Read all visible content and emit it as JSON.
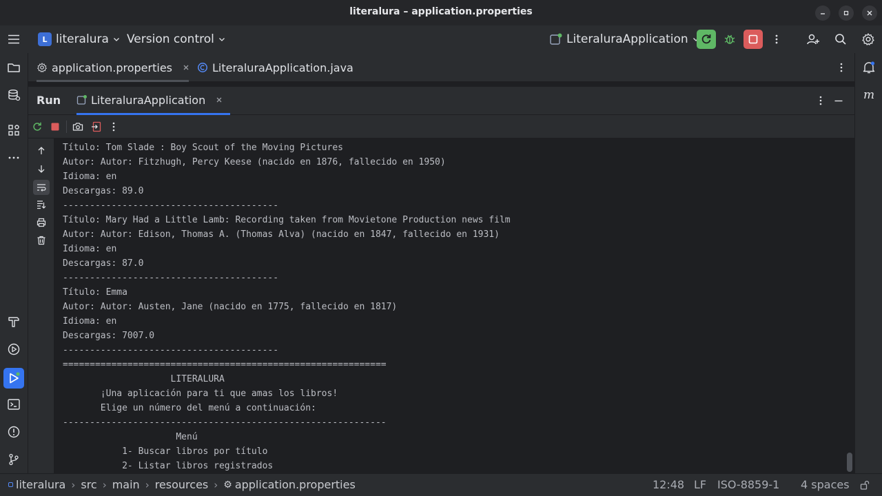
{
  "window": {
    "title": "literalura – application.properties"
  },
  "toolbar": {
    "project_badge": "L",
    "project_name": "literalura",
    "version_control": "Version control",
    "run_config": "LiteraluraApplication"
  },
  "editor_tabs": [
    {
      "label": "application.properties",
      "active": true
    },
    {
      "label": "LiteraluraApplication.java",
      "active": false
    }
  ],
  "run_window": {
    "title": "Run",
    "tab_label": "LiteraluraApplication"
  },
  "console": {
    "lines": [
      "Título: Tom Slade : Boy Scout of the Moving Pictures",
      "Autor: Autor: Fitzhugh, Percy Keese (nacido en 1876, fallecido en 1950)",
      "Idioma: en",
      "Descargas: 89.0",
      "----------------------------------------",
      "Título: Mary Had a Little Lamb: Recording taken from Movietone Production news film",
      "Autor: Autor: Edison, Thomas A. (Thomas Alva) (nacido en 1847, fallecido en 1931)",
      "Idioma: en",
      "Descargas: 87.0",
      "----------------------------------------",
      "Título: Emma",
      "Autor: Autor: Austen, Jane (nacido en 1775, fallecido en 1817)",
      "Idioma: en",
      "Descargas: 7007.0",
      "----------------------------------------",
      "============================================================",
      "                    LITERALURA",
      "       ¡Una aplicación para ti que amas los libros!",
      "       Elige un número del menú a continuación:",
      "------------------------------------------------------------",
      "                     Menú",
      "           1- Buscar libros por título",
      "           2- Listar libros registrados"
    ]
  },
  "statusbar": {
    "breadcrumbs": [
      "literalura",
      "src",
      "main",
      "resources",
      "application.properties"
    ],
    "position": "12:48",
    "line_separator": "LF",
    "encoding": "ISO-8859-1",
    "indent": "4 spaces"
  },
  "colors": {
    "accent": "#3574f0",
    "run_green": "#5fb865",
    "stop_red": "#db5c5c",
    "background": "#1e1f22",
    "panel": "#2b2d30"
  }
}
